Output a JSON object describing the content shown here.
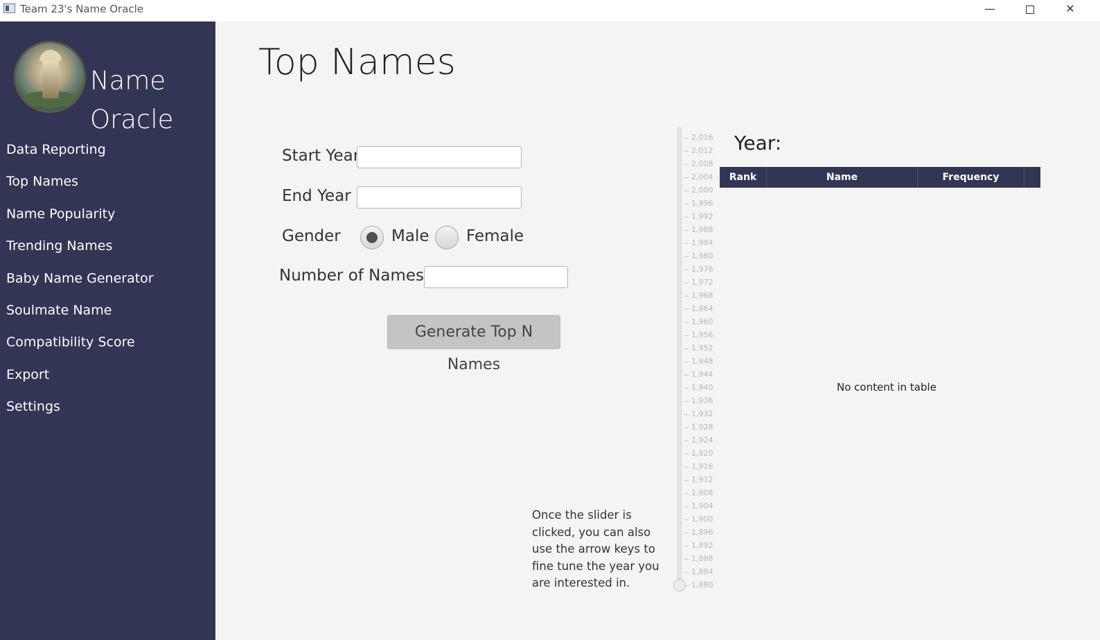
{
  "window": {
    "title": "Team 23's Name Oracle",
    "minimize_glyph": "—",
    "close_glyph": "✕"
  },
  "sidebar": {
    "brand_line1": "Name",
    "brand_line2": "Oracle",
    "items": [
      {
        "label": "Data Reporting"
      },
      {
        "label": "Top Names"
      },
      {
        "label": "Name Popularity"
      },
      {
        "label": "Trending Names"
      },
      {
        "label": "Baby Name Generator"
      },
      {
        "label": "Soulmate Name"
      },
      {
        "label": "Compatibility Score"
      },
      {
        "label": "Export"
      },
      {
        "label": "Settings"
      }
    ]
  },
  "main": {
    "title": "Top Names",
    "form": {
      "start_year_label": "Start Year",
      "start_year_value": "",
      "end_year_label": "End Year",
      "end_year_value": "",
      "gender_label": "Gender",
      "gender_options": [
        "Male",
        "Female"
      ],
      "gender_selected": "Male",
      "number_label": "Number of Names",
      "number_value": ""
    },
    "generate_button": "Generate Top N Names",
    "hint": "Once the slider is clicked, you can also use the arrow keys to fine tune the year you are interested in."
  },
  "slider": {
    "min": 1880,
    "max": 2016,
    "value": 1880,
    "tick_labels": [
      "2,016",
      "2,012",
      "2,008",
      "2,004",
      "2,000",
      "1,996",
      "1,992",
      "1,988",
      "1,984",
      "1,980",
      "1,976",
      "1,972",
      "1,968",
      "1,964",
      "1,960",
      "1,956",
      "1,952",
      "1,948",
      "1,944",
      "1,940",
      "1,936",
      "1,932",
      "1,928",
      "1,924",
      "1,920",
      "1,916",
      "1,912",
      "1,908",
      "1,904",
      "1,900",
      "1,896",
      "1,892",
      "1,888",
      "1,884",
      "1,880"
    ]
  },
  "results": {
    "year_label": "Year:",
    "columns": [
      "Rank",
      "Name",
      "Frequency"
    ],
    "empty_text": "No content in table"
  },
  "colors": {
    "sidebar_bg": "#323553",
    "main_bg": "#f4f4f4",
    "table_header_bg": "#323553"
  }
}
